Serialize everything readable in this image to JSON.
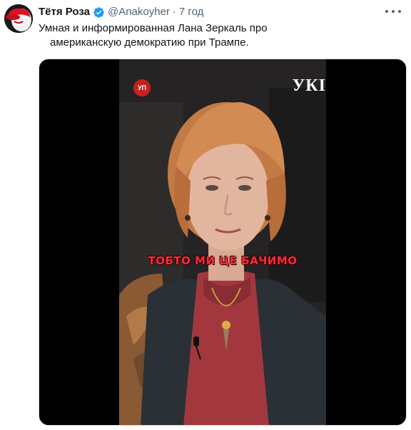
{
  "tweet": {
    "author": {
      "display_name": "Тётя Роза",
      "handle": "@Anakoyher",
      "separator": "·",
      "time": "7 год"
    },
    "text_line1": "Умная и информированная Лана Зеркаль про",
    "text_line2": "американскую демократию при Трампе.",
    "media": {
      "badge_logo": "УП",
      "corner_logo": "УКІ",
      "caption": "ТОБТО МИ ЦЕ БАЧИМО"
    }
  },
  "icons": {
    "verified": "verified-badge-icon",
    "more": "more-dots-icon",
    "avatar": "avatar-red-hat"
  },
  "colors": {
    "verified_blue": "#1d9bf0",
    "caption_red": "#ff2a3a",
    "secondary_text": "#536471"
  }
}
